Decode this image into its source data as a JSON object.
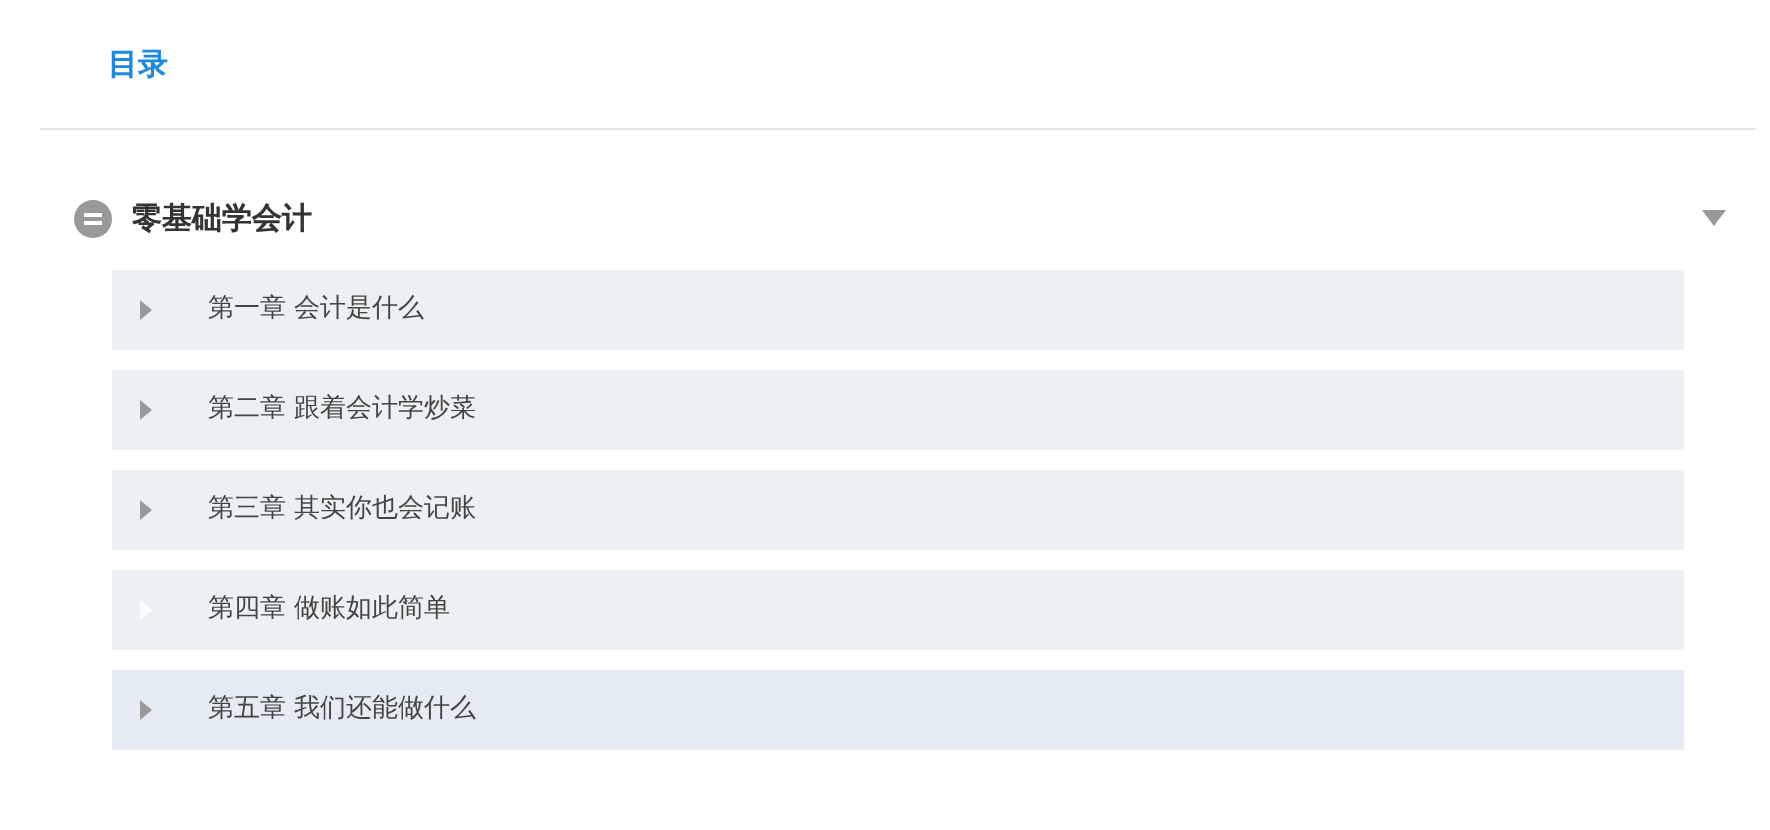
{
  "tabs": [
    {
      "label": "目录",
      "selected": true
    }
  ],
  "section": {
    "title": "零基础学会计",
    "expanded": true,
    "chapters": [
      {
        "title": "第一章 会计是什么",
        "highlighted": false,
        "arrow_faded": false
      },
      {
        "title": "第二章 跟着会计学炒菜",
        "highlighted": false,
        "arrow_faded": false
      },
      {
        "title": "第三章 其实你也会记账",
        "highlighted": false,
        "arrow_faded": false
      },
      {
        "title": "第四章 做账如此简单",
        "highlighted": false,
        "arrow_faded": true
      },
      {
        "title": "第五章 我们还能做什么",
        "highlighted": true,
        "arrow_faded": false
      }
    ]
  }
}
